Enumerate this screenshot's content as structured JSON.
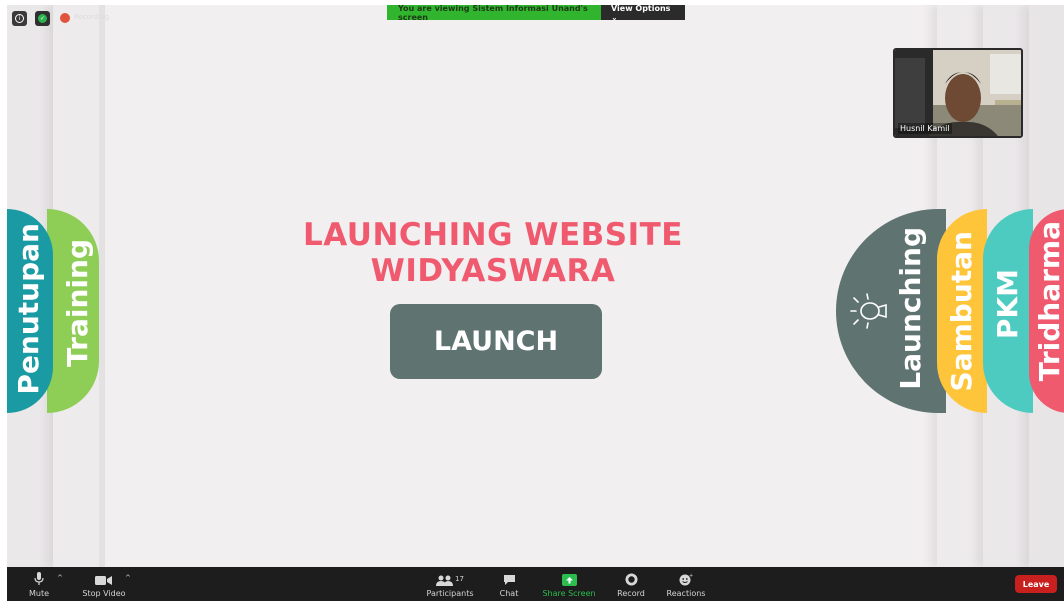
{
  "meeting": {
    "share_banner_text": "You are viewing Sistem Informasi Unand's screen",
    "view_options_label": "View Options ⌄",
    "recording_label": "Recording"
  },
  "slide": {
    "title": "LAUNCHING WEBSITE WIDYASWARA",
    "launch_button": "LAUNCH",
    "left_tabs": [
      {
        "label": "Penutupan",
        "color": "#1a9aa2"
      },
      {
        "label": "Training",
        "color": "#8fce56"
      }
    ],
    "right_tabs": [
      {
        "label": "Launching",
        "color": "#5f7371"
      },
      {
        "label": "Sambutan",
        "color": "#ffc53a"
      },
      {
        "label": "PKM",
        "color": "#4ecbc0"
      },
      {
        "label": "Tridharma",
        "color": "#f05a6e"
      }
    ],
    "title_color": "#f05a6e"
  },
  "participant_video": {
    "name": "Husnil Kamil"
  },
  "toolbar": {
    "mute_label": "Mute",
    "stop_video_label": "Stop Video",
    "participants_label": "Participants",
    "participants_count": "17",
    "chat_label": "Chat",
    "share_screen_label": "Share Screen",
    "record_label": "Record",
    "reactions_label": "Reactions",
    "leave_label": "Leave"
  },
  "icons": {
    "info": "info-icon",
    "shield": "shield-icon",
    "record_dot": "record-dot-icon",
    "microphone": "microphone-icon",
    "camera": "camera-icon",
    "participants": "participants-icon",
    "chat": "chat-icon",
    "share": "share-screen-icon",
    "record": "record-icon",
    "reactions": "reactions-icon",
    "lightbulb": "lightbulb-icon"
  }
}
